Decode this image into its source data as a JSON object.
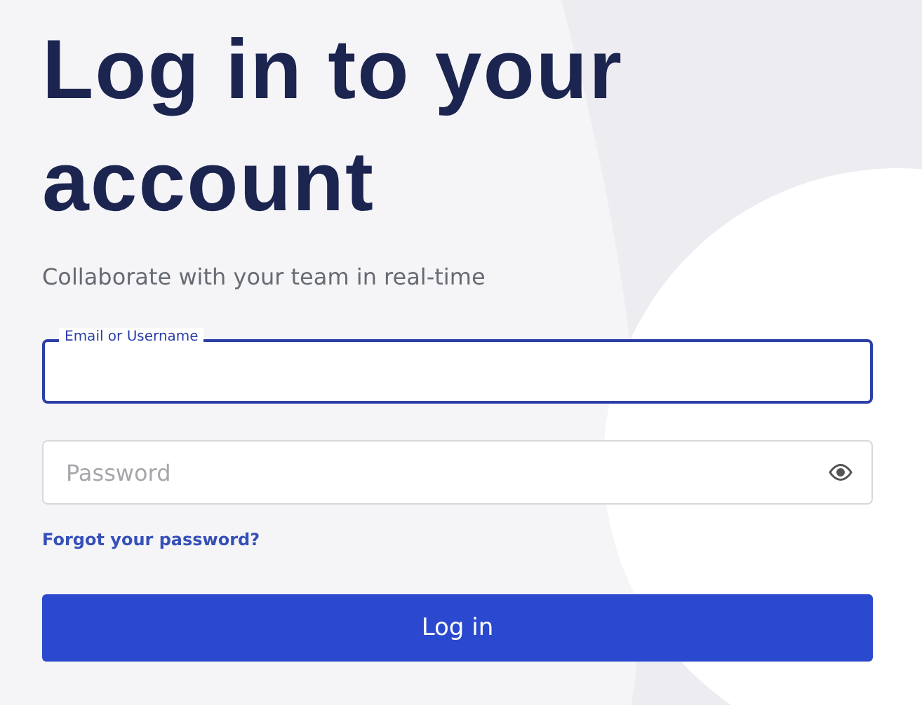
{
  "heading": "Log in to your account",
  "subtitle": "Collaborate with your team in real-time",
  "fields": [
    {
      "kind": "text",
      "label": "Email or Username",
      "focused": true
    },
    {
      "kind": "password",
      "placeholder": "Password",
      "focused": false
    }
  ],
  "forgot_link": "Forgot your password?",
  "submit": "Log in"
}
